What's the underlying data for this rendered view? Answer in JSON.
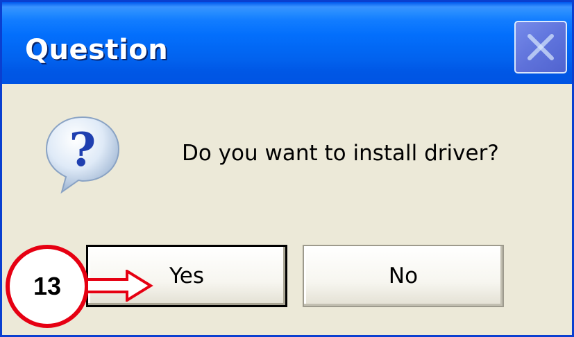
{
  "window": {
    "title": "Question",
    "close_icon": "close-icon"
  },
  "dialog": {
    "icon": "question-icon",
    "message": "Do you want to install driver?"
  },
  "buttons": {
    "yes_label": "Yes",
    "no_label": "No"
  },
  "annotation": {
    "step_number": "13",
    "color": "#e60012"
  },
  "colors": {
    "titlebar": "#0054e3",
    "dialog_bg": "#ece9d8",
    "border": "#0a3fd0"
  }
}
